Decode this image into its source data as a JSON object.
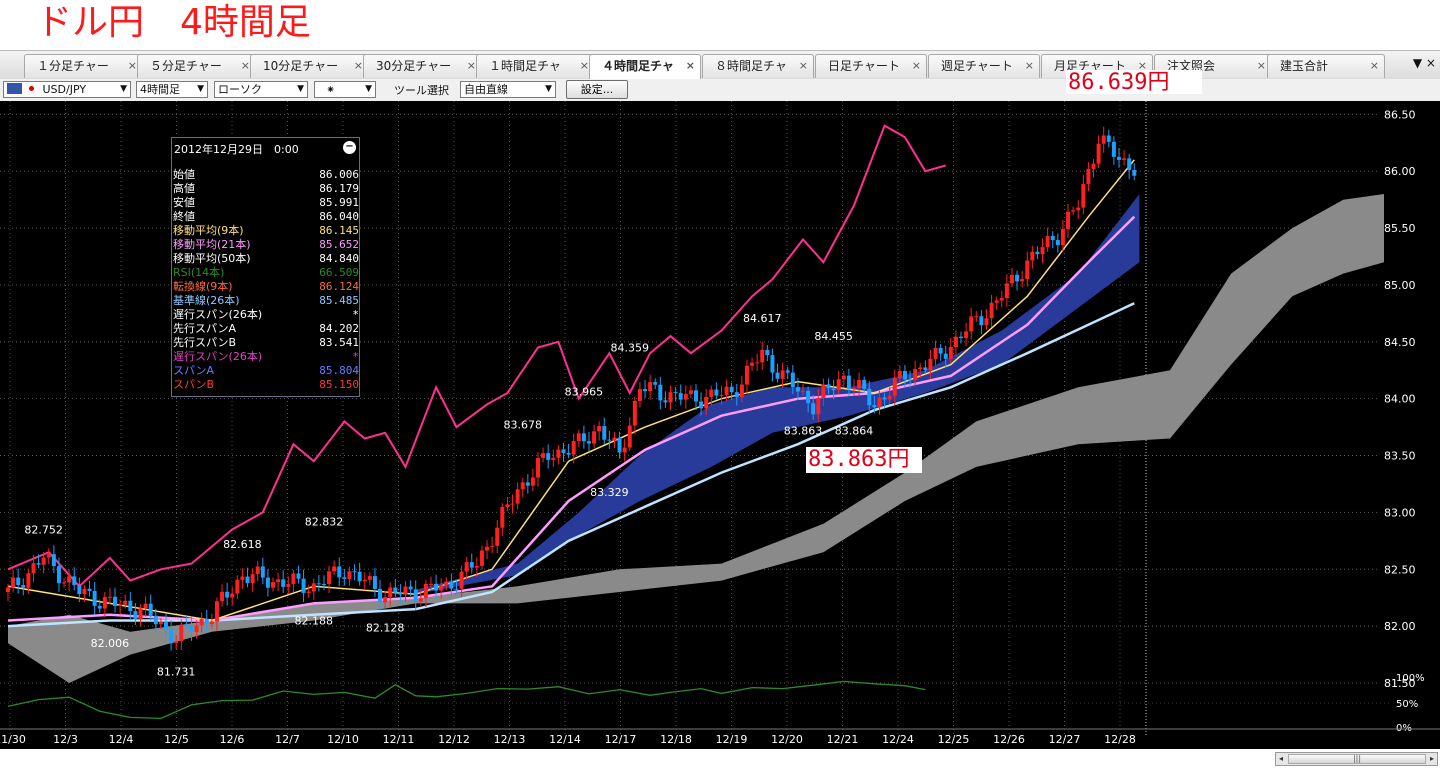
{
  "title": "ドル円　4時間足",
  "tabs": [
    {
      "label": "１分足チャー",
      "x": 24,
      "w": 111
    },
    {
      "label": "５分足チャー",
      "x": 137,
      "w": 111
    },
    {
      "label": "10分足チャー",
      "x": 250,
      "w": 111
    },
    {
      "label": "30分足チャー",
      "x": 363,
      "w": 111
    },
    {
      "label": "１時間足チャ",
      "x": 476,
      "w": 111
    },
    {
      "label": "４時間足チャ",
      "x": 589,
      "w": 104,
      "active": true
    },
    {
      "label": "８時間足チャ",
      "x": 702,
      "w": 104
    },
    {
      "label": "日足チャート",
      "x": 815,
      "w": 104
    },
    {
      "label": "週足チャート",
      "x": 928,
      "w": 104
    },
    {
      "label": "月足チャート",
      "x": 1041,
      "w": 104
    },
    {
      "label": "注文照会",
      "x": 1154,
      "w": 110
    },
    {
      "label": "建玉合計",
      "x": 1267,
      "w": 110
    }
  ],
  "tab_close_glyph": "×",
  "tab_controls": "▼ ×",
  "toolbar": {
    "pair": "USD/JPY",
    "timeframe": "4時間足",
    "chart_type": "ローソク",
    "tool_icon": "⁕",
    "tool_label": "ツール選択",
    "tool_value": "自由直線",
    "settings_button": "設定..."
  },
  "info_box": {
    "datetime": "2012年12月29日　0:00",
    "minimize_glyph": "−",
    "rows": [
      {
        "label": "始値",
        "value": "86.006",
        "color": "#ffffff"
      },
      {
        "label": "高値",
        "value": "86.179",
        "color": "#ffffff"
      },
      {
        "label": "安値",
        "value": "85.991",
        "color": "#ffffff"
      },
      {
        "label": "終値",
        "value": "86.040",
        "color": "#ffffff"
      },
      {
        "label": "移動平均(9本)",
        "value": "86.145",
        "color": "#ffe07a"
      },
      {
        "label": "移動平均(21本)",
        "value": "85.652",
        "color": "#ff9cff"
      },
      {
        "label": "移動平均(50本)",
        "value": "84.840",
        "color": "#ffffff"
      },
      {
        "label": "RSI(14本)",
        "value": "66.509",
        "color": "#2d8a2d"
      },
      {
        "label": "転換線(9本)",
        "value": "86.124",
        "color": "#ff6a3d"
      },
      {
        "label": "基準線(26本)",
        "value": "85.485",
        "color": "#8ec8ff"
      },
      {
        "label": "遅行スパン(26本)",
        "value": "*",
        "color": "#ffffff"
      },
      {
        "label": "先行スパンA",
        "value": "84.202",
        "color": "#ffffff"
      },
      {
        "label": "先行スパンB",
        "value": "83.541",
        "color": "#ffffff"
      },
      {
        "label": "遅行スパン(26本)",
        "value": "*",
        "color": "#e040c0"
      },
      {
        "label": "スパンA",
        "value": "85.804",
        "color": "#6a7aff"
      },
      {
        "label": "スパンB",
        "value": "85.150",
        "color": "#ff3a3a"
      }
    ]
  },
  "annotations": {
    "high_price": "86.639円",
    "low_price": "83.863円"
  },
  "scroll_thumb_glyph": "|||",
  "scroll_left_glyph": "◂",
  "scroll_right_glyph": "▸",
  "colors": {
    "up_candle": "#ff2020",
    "down_candle": "#1aa0ff",
    "rsi_line": "#ff3090",
    "ma9": "#ffe07a",
    "ma21": "#ff9cff",
    "ma50": "#bfe4ff",
    "cloud_gray": "#8a8a8a",
    "cloud_blue": "#283a9a",
    "bg": "#000000"
  },
  "chart_data": {
    "type": "candlestick",
    "pair": "USD/JPY",
    "ylim": [
      81.5,
      86.6
    ],
    "y_ticks": [
      "86.50",
      "86.00",
      "85.50",
      "85.00",
      "84.50",
      "84.00",
      "83.50",
      "83.00",
      "82.50",
      "82.00",
      "81.50"
    ],
    "rsi_ticks": [
      "100%",
      "50%",
      "0%"
    ],
    "x_labels": [
      "11/30",
      "12/3",
      "12/4",
      "12/5",
      "12/6",
      "12/7",
      "12/10",
      "12/11",
      "12/12",
      "12/13",
      "12/14",
      "12/17",
      "12/18",
      "12/19",
      "12/20",
      "12/21",
      "12/24",
      "12/25",
      "12/26",
      "12/27",
      "12/28"
    ],
    "price_labels": [
      {
        "text": "82.752",
        "i": 7,
        "y": 82.79,
        "pos": "above"
      },
      {
        "text": "82.006",
        "i": 20,
        "y": 81.92,
        "pos": "below"
      },
      {
        "text": "81.731",
        "i": 33,
        "y": 81.67,
        "pos": "below"
      },
      {
        "text": "82.618",
        "i": 46,
        "y": 82.66,
        "pos": "above"
      },
      {
        "text": "82.832",
        "i": 62,
        "y": 82.86,
        "pos": "above"
      },
      {
        "text": "82.188",
        "i": 60,
        "y": 82.12,
        "pos": "below"
      },
      {
        "text": "82.128",
        "i": 74,
        "y": 82.06,
        "pos": "below"
      },
      {
        "text": "83.678",
        "i": 101,
        "y": 83.71,
        "pos": "above"
      },
      {
        "text": "83.965",
        "i": 113,
        "y": 84.0,
        "pos": "above"
      },
      {
        "text": "84.359",
        "i": 122,
        "y": 84.39,
        "pos": "above"
      },
      {
        "text": "83.329",
        "i": 118,
        "y": 83.25,
        "pos": "below"
      },
      {
        "text": "84.617",
        "i": 148,
        "y": 84.65,
        "pos": "above"
      },
      {
        "text": "84.455",
        "i": 162,
        "y": 84.49,
        "pos": "above"
      },
      {
        "text": "83.863",
        "i": 156,
        "y": 83.79,
        "pos": "below"
      },
      {
        "text": "83.864",
        "i": 166,
        "y": 83.79,
        "pos": "below"
      },
      {
        "text": "86.639",
        "i": 215,
        "y": 86.68,
        "pos": "above"
      }
    ],
    "anchors": [
      [
        0,
        82.3
      ],
      [
        7,
        82.6
      ],
      [
        14,
        82.3
      ],
      [
        20,
        82.2
      ],
      [
        26,
        82.15
      ],
      [
        33,
        81.9
      ],
      [
        40,
        82.1
      ],
      [
        46,
        82.45
      ],
      [
        52,
        82.4
      ],
      [
        60,
        82.35
      ],
      [
        66,
        82.5
      ],
      [
        74,
        82.28
      ],
      [
        80,
        82.3
      ],
      [
        86,
        82.35
      ],
      [
        92,
        82.55
      ],
      [
        100,
        83.2
      ],
      [
        106,
        83.5
      ],
      [
        112,
        83.6
      ],
      [
        116,
        83.75
      ],
      [
        120,
        83.5
      ],
      [
        124,
        84.1
      ],
      [
        128,
        84.05
      ],
      [
        134,
        84.0
      ],
      [
        142,
        84.05
      ],
      [
        148,
        84.4
      ],
      [
        152,
        84.2
      ],
      [
        158,
        83.95
      ],
      [
        164,
        84.2
      ],
      [
        170,
        83.95
      ],
      [
        176,
        84.2
      ],
      [
        182,
        84.35
      ],
      [
        188,
        84.6
      ],
      [
        194,
        84.85
      ],
      [
        200,
        85.2
      ],
      [
        206,
        85.45
      ],
      [
        210,
        85.7
      ],
      [
        214,
        86.3
      ],
      [
        218,
        86.1
      ],
      [
        221,
        86.04
      ]
    ],
    "rsi_series": [
      [
        0,
        43
      ],
      [
        6,
        57
      ],
      [
        12,
        62
      ],
      [
        18,
        33
      ],
      [
        24,
        20
      ],
      [
        30,
        18
      ],
      [
        36,
        46
      ],
      [
        42,
        55
      ],
      [
        48,
        56
      ],
      [
        54,
        75
      ],
      [
        60,
        68
      ],
      [
        66,
        72
      ],
      [
        72,
        60
      ],
      [
        76,
        88
      ],
      [
        80,
        65
      ],
      [
        84,
        63
      ],
      [
        90,
        70
      ],
      [
        96,
        80
      ],
      [
        102,
        79
      ],
      [
        108,
        84
      ],
      [
        114,
        69
      ],
      [
        120,
        78
      ],
      [
        126,
        66
      ],
      [
        130,
        72
      ],
      [
        136,
        80
      ],
      [
        140,
        70
      ],
      [
        146,
        82
      ],
      [
        152,
        80
      ],
      [
        158,
        87
      ],
      [
        164,
        95
      ],
      [
        170,
        90
      ],
      [
        176,
        86
      ],
      [
        180,
        78
      ]
    ],
    "ma9": [
      [
        0,
        82.35
      ],
      [
        20,
        82.2
      ],
      [
        40,
        82.05
      ],
      [
        60,
        82.35
      ],
      [
        80,
        82.28
      ],
      [
        95,
        82.5
      ],
      [
        110,
        83.45
      ],
      [
        125,
        83.75
      ],
      [
        140,
        84.0
      ],
      [
        155,
        84.15
      ],
      [
        170,
        84.05
      ],
      [
        185,
        84.3
      ],
      [
        200,
        84.9
      ],
      [
        212,
        85.6
      ],
      [
        221,
        86.1
      ]
    ],
    "ma21": [
      [
        0,
        82.05
      ],
      [
        20,
        82.1
      ],
      [
        40,
        82.05
      ],
      [
        60,
        82.2
      ],
      [
        80,
        82.25
      ],
      [
        95,
        82.35
      ],
      [
        110,
        83.1
      ],
      [
        125,
        83.55
      ],
      [
        140,
        83.85
      ],
      [
        155,
        84.0
      ],
      [
        170,
        84.05
      ],
      [
        185,
        84.2
      ],
      [
        200,
        84.65
      ],
      [
        212,
        85.2
      ],
      [
        221,
        85.6
      ]
    ],
    "ma50": [
      [
        0,
        82.0
      ],
      [
        20,
        82.05
      ],
      [
        40,
        82.05
      ],
      [
        60,
        82.1
      ],
      [
        80,
        82.15
      ],
      [
        95,
        82.3
      ],
      [
        110,
        82.75
      ],
      [
        125,
        83.05
      ],
      [
        140,
        83.35
      ],
      [
        155,
        83.6
      ],
      [
        170,
        83.9
      ],
      [
        185,
        84.1
      ],
      [
        200,
        84.4
      ],
      [
        212,
        84.65
      ],
      [
        221,
        84.84
      ]
    ],
    "cloud_gray_top": [
      [
        0,
        82.0
      ],
      [
        12,
        82.1
      ],
      [
        24,
        81.95
      ],
      [
        40,
        82.05
      ],
      [
        60,
        82.2
      ],
      [
        80,
        82.25
      ],
      [
        100,
        82.35
      ],
      [
        120,
        82.5
      ],
      [
        140,
        82.55
      ],
      [
        160,
        82.9
      ],
      [
        176,
        83.35
      ],
      [
        190,
        83.8
      ],
      [
        210,
        84.1
      ],
      [
        228,
        84.25
      ],
      [
        240,
        85.1
      ],
      [
        252,
        85.5
      ],
      [
        262,
        85.75
      ],
      [
        270,
        85.8
      ]
    ],
    "cloud_gray_bottom": [
      [
        0,
        81.85
      ],
      [
        12,
        81.5
      ],
      [
        24,
        81.75
      ],
      [
        40,
        81.95
      ],
      [
        60,
        82.05
      ],
      [
        80,
        82.2
      ],
      [
        100,
        82.2
      ],
      [
        120,
        82.3
      ],
      [
        140,
        82.4
      ],
      [
        160,
        82.65
      ],
      [
        176,
        83.1
      ],
      [
        190,
        83.4
      ],
      [
        210,
        83.6
      ],
      [
        228,
        83.65
      ],
      [
        240,
        84.3
      ],
      [
        252,
        84.9
      ],
      [
        262,
        85.1
      ],
      [
        270,
        85.2
      ]
    ],
    "cloud_blue_top": [
      [
        80,
        82.32
      ],
      [
        100,
        82.55
      ],
      [
        112,
        83.0
      ],
      [
        124,
        83.5
      ],
      [
        138,
        83.95
      ],
      [
        150,
        84.1
      ],
      [
        165,
        84.1
      ],
      [
        180,
        84.25
      ],
      [
        195,
        84.6
      ],
      [
        210,
        85.1
      ],
      [
        222,
        85.8
      ]
    ],
    "cloud_blue_bottom": [
      [
        80,
        82.28
      ],
      [
        100,
        82.45
      ],
      [
        112,
        82.8
      ],
      [
        124,
        83.1
      ],
      [
        138,
        83.4
      ],
      [
        150,
        83.7
      ],
      [
        165,
        83.85
      ],
      [
        180,
        84.05
      ],
      [
        195,
        84.3
      ],
      [
        210,
        84.8
      ],
      [
        222,
        85.2
      ]
    ],
    "delay_line": [
      [
        0,
        82.5
      ],
      [
        8,
        82.65
      ],
      [
        14,
        82.35
      ],
      [
        20,
        82.6
      ],
      [
        24,
        82.4
      ],
      [
        30,
        82.5
      ],
      [
        36,
        82.55
      ],
      [
        40,
        82.7
      ],
      [
        44,
        82.85
      ],
      [
        50,
        83.0
      ],
      [
        56,
        83.6
      ],
      [
        60,
        83.45
      ],
      [
        66,
        83.8
      ],
      [
        70,
        83.65
      ],
      [
        74,
        83.7
      ],
      [
        78,
        83.4
      ],
      [
        84,
        84.1
      ],
      [
        88,
        83.75
      ],
      [
        94,
        83.95
      ],
      [
        98,
        84.05
      ],
      [
        104,
        84.45
      ],
      [
        108,
        84.5
      ],
      [
        112,
        84.0
      ],
      [
        118,
        84.4
      ],
      [
        122,
        84.05
      ],
      [
        126,
        84.4
      ],
      [
        130,
        84.55
      ],
      [
        134,
        84.4
      ],
      [
        140,
        84.6
      ],
      [
        146,
        84.9
      ],
      [
        150,
        85.05
      ],
      [
        156,
        85.4
      ],
      [
        160,
        85.2
      ],
      [
        166,
        85.7
      ],
      [
        172,
        86.4
      ],
      [
        176,
        86.3
      ],
      [
        180,
        86.0
      ],
      [
        184,
        86.05
      ]
    ]
  }
}
